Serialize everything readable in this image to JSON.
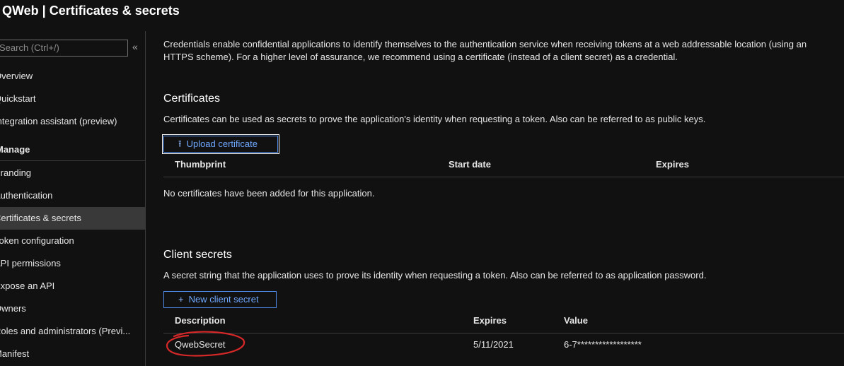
{
  "header": {
    "title": "QWeb | Certificates & secrets"
  },
  "sidebar": {
    "search_placeholder": "Search (Ctrl+/)",
    "collapse_glyph": "«",
    "items": [
      {
        "label": "Overview"
      },
      {
        "label": "Quickstart"
      },
      {
        "label": "Integration assistant (preview)"
      }
    ],
    "manage_section": "Manage",
    "manage_items": [
      {
        "label": "Branding"
      },
      {
        "label": "Authentication"
      },
      {
        "label": "Certificates & secrets"
      },
      {
        "label": "Token configuration"
      },
      {
        "label": "API permissions"
      },
      {
        "label": "Expose an API"
      },
      {
        "label": "Owners"
      },
      {
        "label": "Roles and administrators (Previ..."
      },
      {
        "label": "Manifest"
      }
    ]
  },
  "main": {
    "intro": "Credentials enable confidential applications to identify themselves to the authentication service when receiving tokens at a web addressable location (using an HTTPS scheme). For a higher level of assurance, we recommend using a certificate (instead of a client secret) as a credential.",
    "certificates": {
      "title": "Certificates",
      "description": "Certificates can be used as secrets to prove the application's identity when requesting a token. Also can be referred to as public keys.",
      "upload_label": "Upload certificate",
      "upload_glyph": "⭱",
      "columns": [
        "Thumbprint",
        "Start date",
        "Expires"
      ],
      "empty_message": "No certificates have been added for this application."
    },
    "client_secrets": {
      "title": "Client secrets",
      "description": "A secret string that the application uses to prove its identity when requesting a token. Also can be referred to as application password.",
      "new_label": "New client secret",
      "new_glyph": "+",
      "columns": [
        "Description",
        "Expires",
        "Value"
      ],
      "rows": [
        {
          "description": "QwebSecret",
          "expires": "5/11/2021",
          "value": "6-7******************"
        }
      ]
    }
  },
  "colors": {
    "background": "#111111",
    "accent": "#4f89e8",
    "annotation": "#d62828"
  }
}
